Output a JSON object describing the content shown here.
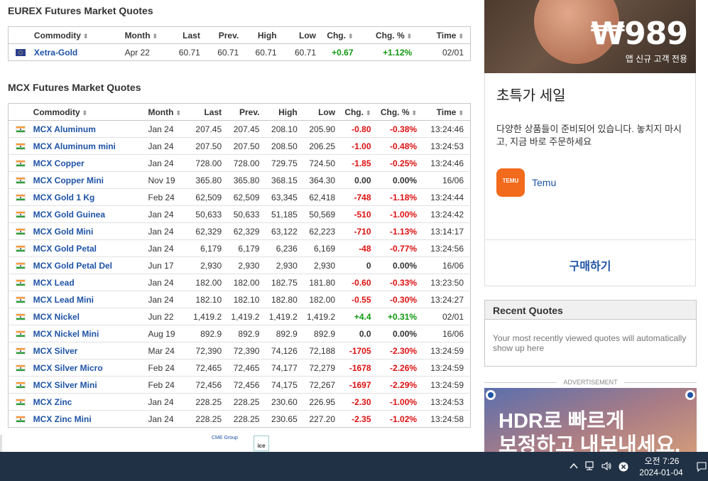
{
  "eurex": {
    "title": "EUREX Futures Market Quotes",
    "headers": [
      "Commodity",
      "Month",
      "Last",
      "Prev.",
      "High",
      "Low",
      "Chg.",
      "Chg. %",
      "Time"
    ],
    "rows": [
      {
        "name": "Xetra-Gold",
        "month": "Apr 22",
        "last": "60.71",
        "prev": "60.71",
        "high": "60.71",
        "low": "60.71",
        "chg": "+0.67",
        "chgp": "+1.12%",
        "time": "02/01",
        "dir": "pos"
      }
    ]
  },
  "mcx": {
    "title": "MCX Futures Market Quotes",
    "headers": [
      "Commodity",
      "Month",
      "Last",
      "Prev.",
      "High",
      "Low",
      "Chg.",
      "Chg. %",
      "Time"
    ],
    "rows": [
      {
        "name": "MCX Aluminum",
        "month": "Jan 24",
        "last": "207.45",
        "prev": "207.45",
        "high": "208.10",
        "low": "205.90",
        "chg": "-0.80",
        "chgp": "-0.38%",
        "time": "13:24:46",
        "dir": "neg"
      },
      {
        "name": "MCX Aluminum mini",
        "month": "Jan 24",
        "last": "207.50",
        "prev": "207.50",
        "high": "208.50",
        "low": "206.25",
        "chg": "-1.00",
        "chgp": "-0.48%",
        "time": "13:24:53",
        "dir": "neg"
      },
      {
        "name": "MCX Copper",
        "month": "Jan 24",
        "last": "728.00",
        "prev": "728.00",
        "high": "729.75",
        "low": "724.50",
        "chg": "-1.85",
        "chgp": "-0.25%",
        "time": "13:24:46",
        "dir": "neg"
      },
      {
        "name": "MCX Copper Mini",
        "month": "Nov 19",
        "last": "365.80",
        "prev": "365.80",
        "high": "368.15",
        "low": "364.30",
        "chg": "0.00",
        "chgp": "0.00%",
        "time": "16/06",
        "dir": "zero"
      },
      {
        "name": "MCX Gold 1 Kg",
        "month": "Feb 24",
        "last": "62,509",
        "prev": "62,509",
        "high": "63,345",
        "low": "62,418",
        "chg": "-748",
        "chgp": "-1.18%",
        "time": "13:24:44",
        "dir": "neg"
      },
      {
        "name": "MCX Gold Guinea",
        "month": "Jan 24",
        "last": "50,633",
        "prev": "50,633",
        "high": "51,185",
        "low": "50,569",
        "chg": "-510",
        "chgp": "-1.00%",
        "time": "13:24:42",
        "dir": "neg"
      },
      {
        "name": "MCX Gold Mini",
        "month": "Jan 24",
        "last": "62,329",
        "prev": "62,329",
        "high": "63,122",
        "low": "62,223",
        "chg": "-710",
        "chgp": "-1.13%",
        "time": "13:14:17",
        "dir": "neg"
      },
      {
        "name": "MCX Gold Petal",
        "month": "Jan 24",
        "last": "6,179",
        "prev": "6,179",
        "high": "6,236",
        "low": "6,169",
        "chg": "-48",
        "chgp": "-0.77%",
        "time": "13:24:56",
        "dir": "neg"
      },
      {
        "name": "MCX Gold Petal Del",
        "month": "Jun 17",
        "last": "2,930",
        "prev": "2,930",
        "high": "2,930",
        "low": "2,930",
        "chg": "0",
        "chgp": "0.00%",
        "time": "16/06",
        "dir": "zero"
      },
      {
        "name": "MCX Lead",
        "month": "Jan 24",
        "last": "182.00",
        "prev": "182.00",
        "high": "182.75",
        "low": "181.80",
        "chg": "-0.60",
        "chgp": "-0.33%",
        "time": "13:23:50",
        "dir": "neg"
      },
      {
        "name": "MCX Lead Mini",
        "month": "Jan 24",
        "last": "182.10",
        "prev": "182.10",
        "high": "182.80",
        "low": "182.00",
        "chg": "-0.55",
        "chgp": "-0.30%",
        "time": "13:24:27",
        "dir": "neg"
      },
      {
        "name": "MCX Nickel",
        "month": "Jun 22",
        "last": "1,419.2",
        "prev": "1,419.2",
        "high": "1,419.2",
        "low": "1,419.2",
        "chg": "+4.4",
        "chgp": "+0.31%",
        "time": "02/01",
        "dir": "pos"
      },
      {
        "name": "MCX Nickel Mini",
        "month": "Aug 19",
        "last": "892.9",
        "prev": "892.9",
        "high": "892.9",
        "low": "892.9",
        "chg": "0.0",
        "chgp": "0.00%",
        "time": "16/06",
        "dir": "zero"
      },
      {
        "name": "MCX Silver",
        "month": "Mar 24",
        "last": "72,390",
        "prev": "72,390",
        "high": "74,126",
        "low": "72,188",
        "chg": "-1705",
        "chgp": "-2.30%",
        "time": "13:24:59",
        "dir": "neg"
      },
      {
        "name": "MCX Silver Micro",
        "month": "Feb 24",
        "last": "72,465",
        "prev": "72,465",
        "high": "74,177",
        "low": "72,279",
        "chg": "-1678",
        "chgp": "-2.26%",
        "time": "13:24:59",
        "dir": "neg"
      },
      {
        "name": "MCX Silver Mini",
        "month": "Feb 24",
        "last": "72,456",
        "prev": "72,456",
        "high": "74,175",
        "low": "72,267",
        "chg": "-1697",
        "chgp": "-2.29%",
        "time": "13:24:59",
        "dir": "neg"
      },
      {
        "name": "MCX Zinc",
        "month": "Jan 24",
        "last": "228.25",
        "prev": "228.25",
        "high": "230.60",
        "low": "226.95",
        "chg": "-2.30",
        "chgp": "-1.00%",
        "time": "13:24:53",
        "dir": "neg"
      },
      {
        "name": "MCX Zinc Mini",
        "month": "Jan 24",
        "last": "228.25",
        "prev": "228.25",
        "high": "230.65",
        "low": "227.20",
        "chg": "-2.35",
        "chgp": "-1.02%",
        "time": "13:24:58",
        "dir": "neg"
      }
    ]
  },
  "footer_logos": {
    "cme": "CME Group",
    "ice": "ice"
  },
  "ad_top": {
    "price": "₩989",
    "sub": "앱 신규 고객 전용"
  },
  "ad_card": {
    "headline": "초특가 세일",
    "desc": "다양한 상품들이 준비되어 있습니다. 놓치지 마시고, 지금 바로 주문하세요",
    "logo_text": "TEMU",
    "brand": "Temu",
    "cta": "구매하기"
  },
  "recent": {
    "title": "Recent Quotes",
    "body": "Your most recently viewed quotes will automatically show up here"
  },
  "ad_label": "ADVERTISEMENT",
  "ad_bottom": {
    "line1": "HDR로 빠르게",
    "line2": "보정하고 내보내세요."
  },
  "taskbar": {
    "time": "오전 7:26",
    "date": "2024-01-04"
  },
  "colors": {
    "positive": "#109910",
    "negative": "#dd1111",
    "link": "#1e53a5",
    "taskbar": "#203146"
  }
}
